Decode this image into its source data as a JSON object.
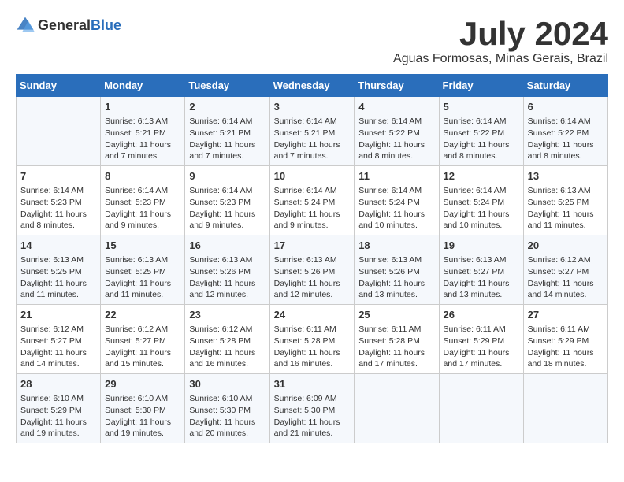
{
  "logo": {
    "general": "General",
    "blue": "Blue"
  },
  "title": "July 2024",
  "subtitle": "Aguas Formosas, Minas Gerais, Brazil",
  "weekdays": [
    "Sunday",
    "Monday",
    "Tuesday",
    "Wednesday",
    "Thursday",
    "Friday",
    "Saturday"
  ],
  "weeks": [
    [
      {
        "day": "",
        "info": ""
      },
      {
        "day": "1",
        "info": "Sunrise: 6:13 AM\nSunset: 5:21 PM\nDaylight: 11 hours\nand 7 minutes."
      },
      {
        "day": "2",
        "info": "Sunrise: 6:14 AM\nSunset: 5:21 PM\nDaylight: 11 hours\nand 7 minutes."
      },
      {
        "day": "3",
        "info": "Sunrise: 6:14 AM\nSunset: 5:21 PM\nDaylight: 11 hours\nand 7 minutes."
      },
      {
        "day": "4",
        "info": "Sunrise: 6:14 AM\nSunset: 5:22 PM\nDaylight: 11 hours\nand 8 minutes."
      },
      {
        "day": "5",
        "info": "Sunrise: 6:14 AM\nSunset: 5:22 PM\nDaylight: 11 hours\nand 8 minutes."
      },
      {
        "day": "6",
        "info": "Sunrise: 6:14 AM\nSunset: 5:22 PM\nDaylight: 11 hours\nand 8 minutes."
      }
    ],
    [
      {
        "day": "7",
        "info": "Sunrise: 6:14 AM\nSunset: 5:23 PM\nDaylight: 11 hours\nand 8 minutes."
      },
      {
        "day": "8",
        "info": "Sunrise: 6:14 AM\nSunset: 5:23 PM\nDaylight: 11 hours\nand 9 minutes."
      },
      {
        "day": "9",
        "info": "Sunrise: 6:14 AM\nSunset: 5:23 PM\nDaylight: 11 hours\nand 9 minutes."
      },
      {
        "day": "10",
        "info": "Sunrise: 6:14 AM\nSunset: 5:24 PM\nDaylight: 11 hours\nand 9 minutes."
      },
      {
        "day": "11",
        "info": "Sunrise: 6:14 AM\nSunset: 5:24 PM\nDaylight: 11 hours\nand 10 minutes."
      },
      {
        "day": "12",
        "info": "Sunrise: 6:14 AM\nSunset: 5:24 PM\nDaylight: 11 hours\nand 10 minutes."
      },
      {
        "day": "13",
        "info": "Sunrise: 6:13 AM\nSunset: 5:25 PM\nDaylight: 11 hours\nand 11 minutes."
      }
    ],
    [
      {
        "day": "14",
        "info": "Sunrise: 6:13 AM\nSunset: 5:25 PM\nDaylight: 11 hours\nand 11 minutes."
      },
      {
        "day": "15",
        "info": "Sunrise: 6:13 AM\nSunset: 5:25 PM\nDaylight: 11 hours\nand 11 minutes."
      },
      {
        "day": "16",
        "info": "Sunrise: 6:13 AM\nSunset: 5:26 PM\nDaylight: 11 hours\nand 12 minutes."
      },
      {
        "day": "17",
        "info": "Sunrise: 6:13 AM\nSunset: 5:26 PM\nDaylight: 11 hours\nand 12 minutes."
      },
      {
        "day": "18",
        "info": "Sunrise: 6:13 AM\nSunset: 5:26 PM\nDaylight: 11 hours\nand 13 minutes."
      },
      {
        "day": "19",
        "info": "Sunrise: 6:13 AM\nSunset: 5:27 PM\nDaylight: 11 hours\nand 13 minutes."
      },
      {
        "day": "20",
        "info": "Sunrise: 6:12 AM\nSunset: 5:27 PM\nDaylight: 11 hours\nand 14 minutes."
      }
    ],
    [
      {
        "day": "21",
        "info": "Sunrise: 6:12 AM\nSunset: 5:27 PM\nDaylight: 11 hours\nand 14 minutes."
      },
      {
        "day": "22",
        "info": "Sunrise: 6:12 AM\nSunset: 5:27 PM\nDaylight: 11 hours\nand 15 minutes."
      },
      {
        "day": "23",
        "info": "Sunrise: 6:12 AM\nSunset: 5:28 PM\nDaylight: 11 hours\nand 16 minutes."
      },
      {
        "day": "24",
        "info": "Sunrise: 6:11 AM\nSunset: 5:28 PM\nDaylight: 11 hours\nand 16 minutes."
      },
      {
        "day": "25",
        "info": "Sunrise: 6:11 AM\nSunset: 5:28 PM\nDaylight: 11 hours\nand 17 minutes."
      },
      {
        "day": "26",
        "info": "Sunrise: 6:11 AM\nSunset: 5:29 PM\nDaylight: 11 hours\nand 17 minutes."
      },
      {
        "day": "27",
        "info": "Sunrise: 6:11 AM\nSunset: 5:29 PM\nDaylight: 11 hours\nand 18 minutes."
      }
    ],
    [
      {
        "day": "28",
        "info": "Sunrise: 6:10 AM\nSunset: 5:29 PM\nDaylight: 11 hours\nand 19 minutes."
      },
      {
        "day": "29",
        "info": "Sunrise: 6:10 AM\nSunset: 5:30 PM\nDaylight: 11 hours\nand 19 minutes."
      },
      {
        "day": "30",
        "info": "Sunrise: 6:10 AM\nSunset: 5:30 PM\nDaylight: 11 hours\nand 20 minutes."
      },
      {
        "day": "31",
        "info": "Sunrise: 6:09 AM\nSunset: 5:30 PM\nDaylight: 11 hours\nand 21 minutes."
      },
      {
        "day": "",
        "info": ""
      },
      {
        "day": "",
        "info": ""
      },
      {
        "day": "",
        "info": ""
      }
    ]
  ]
}
